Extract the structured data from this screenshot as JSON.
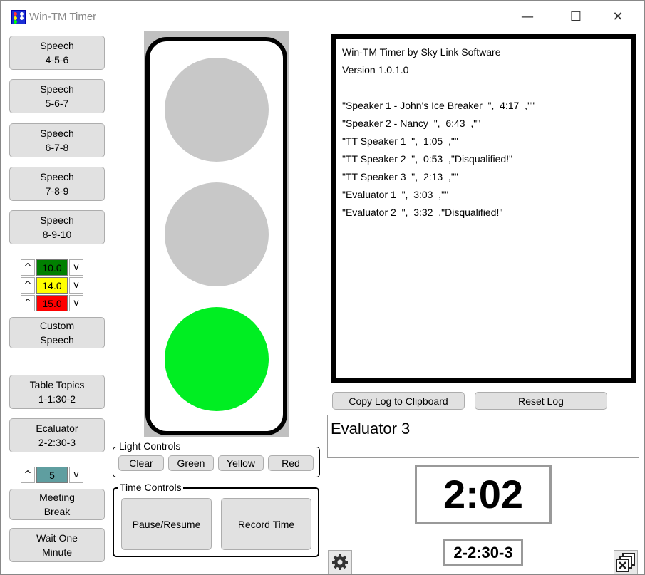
{
  "window": {
    "title": "Win-TM Timer",
    "minimize_glyph": "—",
    "maximize_glyph": "☐",
    "close_glyph": "✕"
  },
  "sidebar": {
    "speech_buttons": [
      {
        "line1": "Speech",
        "line2": "4-5-6"
      },
      {
        "line1": "Speech",
        "line2": "5-6-7"
      },
      {
        "line1": "Speech",
        "line2": "6-7-8"
      },
      {
        "line1": "Speech",
        "line2": "7-8-9"
      },
      {
        "line1": "Speech",
        "line2": "8-9-10"
      }
    ],
    "custom": {
      "up": "^",
      "down": "v",
      "green_value": "10.0",
      "yellow_value": "14.0",
      "red_value": "15.0",
      "colors": {
        "green": "#008000",
        "yellow": "#ffff00",
        "red": "#ff0000"
      }
    },
    "custom_button": {
      "line1": "Custom",
      "line2": "Speech"
    },
    "table_topics_button": {
      "line1": "Table Topics",
      "line2": "1-1:30-2"
    },
    "evaluator_button": {
      "line1": "Ecaluator",
      "line2": "2-2:30-3"
    },
    "evaluator_count": {
      "up": "^",
      "down": "v",
      "value": "5",
      "color": "#5f9ea0"
    },
    "meeting_break_button": {
      "line1": "Meeting",
      "line2": "Break"
    },
    "wait_button": {
      "line1": "Wait One",
      "line2": "Minute"
    }
  },
  "traffic_light": {
    "active": "green",
    "colors": {
      "off": "#c8c8c8",
      "green": "#00ee22"
    }
  },
  "light_controls": {
    "title": "Light Controls",
    "clear": "Clear",
    "green": "Green",
    "yellow": "Yellow",
    "red": "Red"
  },
  "time_controls": {
    "title": "Time Controls",
    "pause": "Pause/Resume",
    "record": "Record Time"
  },
  "log": {
    "lines": [
      "Win-TM Timer by Sky Link Software",
      "Version 1.0.1.0",
      "",
      "\"Speaker 1 - John's Ice Breaker  \",  4:17  ,\"\"",
      "\"Speaker 2 - Nancy  \",  6:43  ,\"\"",
      "\"TT Speaker 1  \",  1:05  ,\"\"",
      "\"TT Speaker 2  \",  0:53  ,\"Disqualified!\"",
      "\"TT Speaker 3  \",  2:13  ,\"\"",
      "\"Evaluator 1  \",  3:03  ,\"\"",
      "\"Evaluator 2  \",  3:32  ,\"Disqualified!\""
    ],
    "copy_button": "Copy Log to Clipboard",
    "reset_button": "Reset Log"
  },
  "current_speaker": "Evaluator 3",
  "timer_display": "2:02",
  "timing_code": "2-2:30-3",
  "icons": {
    "settings": "gear-icon",
    "restore": "window-restore-icon"
  }
}
